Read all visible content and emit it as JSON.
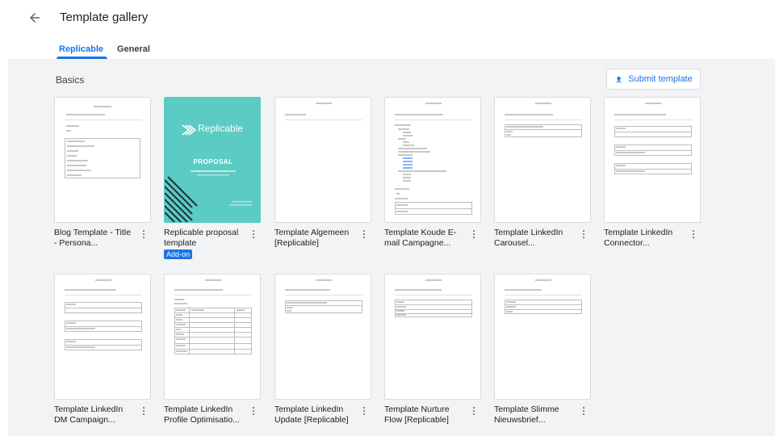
{
  "header": {
    "title": "Template gallery"
  },
  "tabs": [
    {
      "label": "Replicable",
      "active": true
    },
    {
      "label": "General",
      "active": false
    }
  ],
  "section": {
    "title": "Basics"
  },
  "submit_button": {
    "label": "Submit template"
  },
  "cards": [
    {
      "name": "Blog Template - Title - Persona..."
    },
    {
      "name": "Replicable proposal template",
      "badge": "Add-on",
      "brand": "Replicable",
      "heading": "PROPOSAL"
    },
    {
      "name": "Template Algemeen [Replicable]"
    },
    {
      "name": "Template Koude E-mail Campagne..."
    },
    {
      "name": "Template LinkedIn Carousel..."
    },
    {
      "name": "Template LinkedIn Connector..."
    },
    {
      "name": "Template LinkedIn DM Campaign..."
    },
    {
      "name": "Template LinkedIn Profile Optimisatio..."
    },
    {
      "name": "Template LinkedIn Update [Replicable]"
    },
    {
      "name": "Template Nurture Flow [Replicable]"
    },
    {
      "name": "Template Slimme Nieuwsbrief..."
    }
  ],
  "colors": {
    "accent": "#1a73e8",
    "background": "#f1f3f4",
    "teal": "#5ccbc3"
  }
}
